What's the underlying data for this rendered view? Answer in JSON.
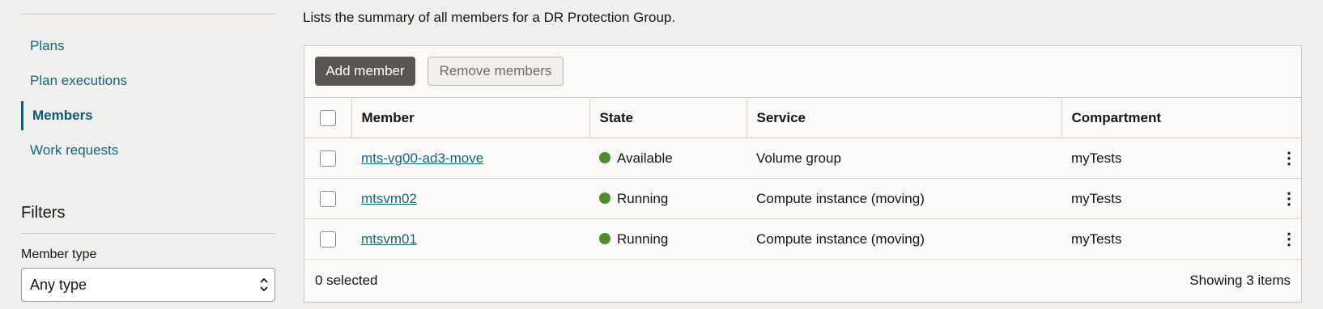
{
  "sidebar": {
    "nav": [
      {
        "label": "Plans",
        "active": false
      },
      {
        "label": "Plan executions",
        "active": false
      },
      {
        "label": "Members",
        "active": true
      },
      {
        "label": "Work requests",
        "active": false
      }
    ],
    "filters_title": "Filters",
    "member_type_label": "Member type",
    "member_type_value": "Any type"
  },
  "main": {
    "description": "Lists the summary of all members for a DR Protection Group.",
    "add_member": "Add member",
    "remove_members": "Remove members",
    "columns": [
      "Member",
      "State",
      "Service",
      "Compartment"
    ],
    "rows": [
      {
        "member": "mts-vg00-ad3-move",
        "state": "Available",
        "service": "Volume group",
        "compartment": "myTests"
      },
      {
        "member": "mtsvm02",
        "state": "Running",
        "service": "Compute instance (moving)",
        "compartment": "myTests"
      },
      {
        "member": "mtsvm01",
        "state": "Running",
        "service": "Compute instance (moving)",
        "compartment": "myTests"
      }
    ],
    "selected_text": "0 selected",
    "showing_text": "Showing 3 items",
    "status_color": "#508a2f"
  }
}
